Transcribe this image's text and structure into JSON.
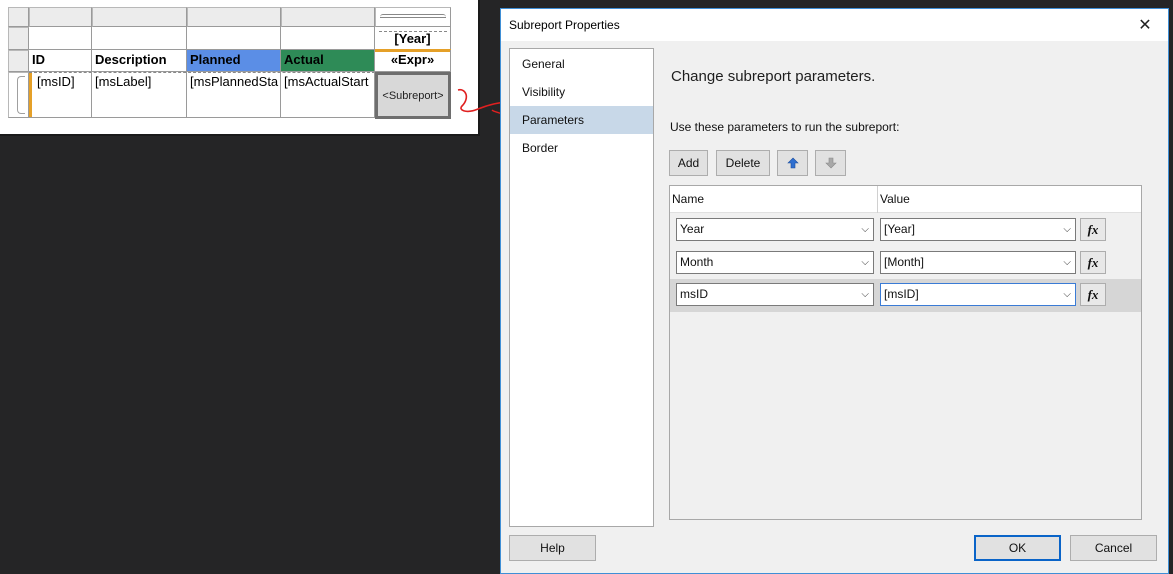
{
  "report": {
    "headers": {
      "id": "ID",
      "description": "Description",
      "planned": "Planned",
      "actual": "Actual",
      "year": "[Year]",
      "expr": "«Expr»"
    },
    "detail": {
      "id": "[msID]",
      "label": "[msLabel]",
      "planned": "[msPlannedSta",
      "actual": "[msActualStart"
    },
    "subreport_label": "<Subreport>",
    "colors": {
      "planned": "#5b8ee6",
      "actual": "#2e8b57",
      "selection": "#e5a028",
      "annotation": "#e02020"
    }
  },
  "dialog": {
    "title": "Subreport Properties",
    "nav": [
      {
        "label": "General"
      },
      {
        "label": "Visibility"
      },
      {
        "label": "Parameters",
        "selected": true
      },
      {
        "label": "Border"
      }
    ],
    "heading": "Change subreport parameters.",
    "instruction": "Use these parameters to run the subreport:",
    "toolbar": {
      "add": "Add",
      "delete": "Delete"
    },
    "grid": {
      "columns": {
        "name": "Name",
        "value": "Value"
      },
      "rows": [
        {
          "name": "Year",
          "value": "[Year]"
        },
        {
          "name": "Month",
          "value": "[Month]"
        },
        {
          "name": "msID",
          "value": "[msID]"
        }
      ]
    },
    "fx_label": "fx",
    "footer": {
      "help": "Help",
      "ok": "OK",
      "cancel": "Cancel"
    },
    "colors": {
      "accent": "#3f8fd6",
      "nav_selected": "#c8d8e8"
    }
  }
}
